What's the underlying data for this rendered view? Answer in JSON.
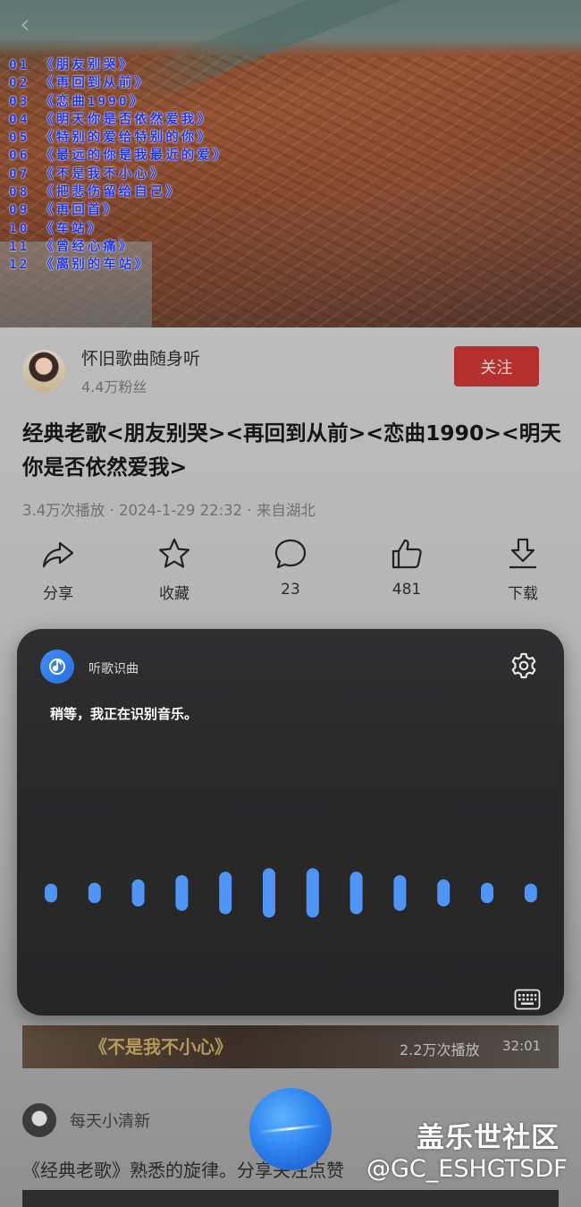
{
  "playlist": [
    "01 《朋友别哭》",
    "02 《再回到从前》",
    "03 《恋曲1990》",
    "04 《明天你是否依然爱我》",
    "05 《特别的爱给特别的你》",
    "06 《最远的你是我最近的爱》",
    "07 《不是我不小心》",
    "08 《把悲伤留给自己》",
    "09 《再回首》",
    "10 《车站》",
    "11 《曾经心痛》",
    "12 《离别的车站》"
  ],
  "author": {
    "name": "怀旧歌曲随身听",
    "fans": "4.4万粉丝",
    "follow_label": "关注"
  },
  "video": {
    "title": "经典老歌<朋友别哭><再回到从前><恋曲1990><明天你是否依然爱我>",
    "meta": "3.4万次播放 · 2024-1-29 22:32 · 来自湖北"
  },
  "actions": {
    "share": "分享",
    "favorite": "收藏",
    "comment_count": "23",
    "like_count": "481",
    "download": "下载"
  },
  "recommended": {
    "thumb_text": "《不是我不小心》",
    "views": "2.2万次播放",
    "duration": "32:01",
    "second_author": "每天小清新",
    "second_title": "《经典老歌》熟悉的旋律。分享关注点赞"
  },
  "recognition_panel": {
    "app_name": "听歌识曲",
    "status": "稍等，我正在识别音乐。",
    "wave_levels": [
      0.22,
      0.24,
      0.32,
      0.42,
      0.5,
      0.58,
      0.58,
      0.5,
      0.42,
      0.32,
      0.24,
      0.22
    ],
    "accent_color": "#4f94f7"
  },
  "watermark": {
    "line1": "盖乐世社区",
    "line2": "@GC_ESHGTSDF"
  },
  "icons": {
    "back": "back-arrow-icon",
    "share": "share-icon",
    "favorite": "star-icon",
    "comment": "comment-icon",
    "like": "thumbs-up-icon",
    "download": "download-icon",
    "settings": "gear-icon",
    "keyboard": "keyboard-icon"
  }
}
